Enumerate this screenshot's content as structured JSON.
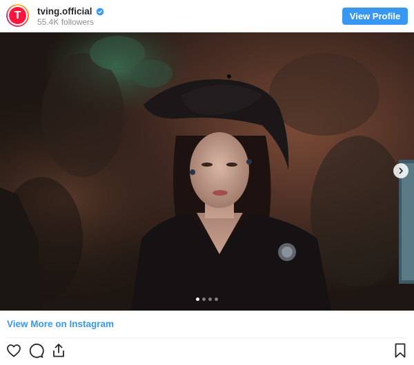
{
  "profile": {
    "avatar_letter": "T",
    "username": "tving.official",
    "verified": true,
    "followers": "55.4K followers",
    "view_profile_label": "View Profile"
  },
  "post": {
    "image_count": 4,
    "active_index": 0
  },
  "links": {
    "view_more": "View More on Instagram"
  },
  "colors": {
    "accent": "#3897f0",
    "logo": "#ff153c",
    "verified": "#3897f0"
  },
  "icons": [
    "heart-icon",
    "comment-icon",
    "share-icon",
    "bookmark-icon",
    "chevron-right-icon",
    "verified-badge-icon"
  ]
}
